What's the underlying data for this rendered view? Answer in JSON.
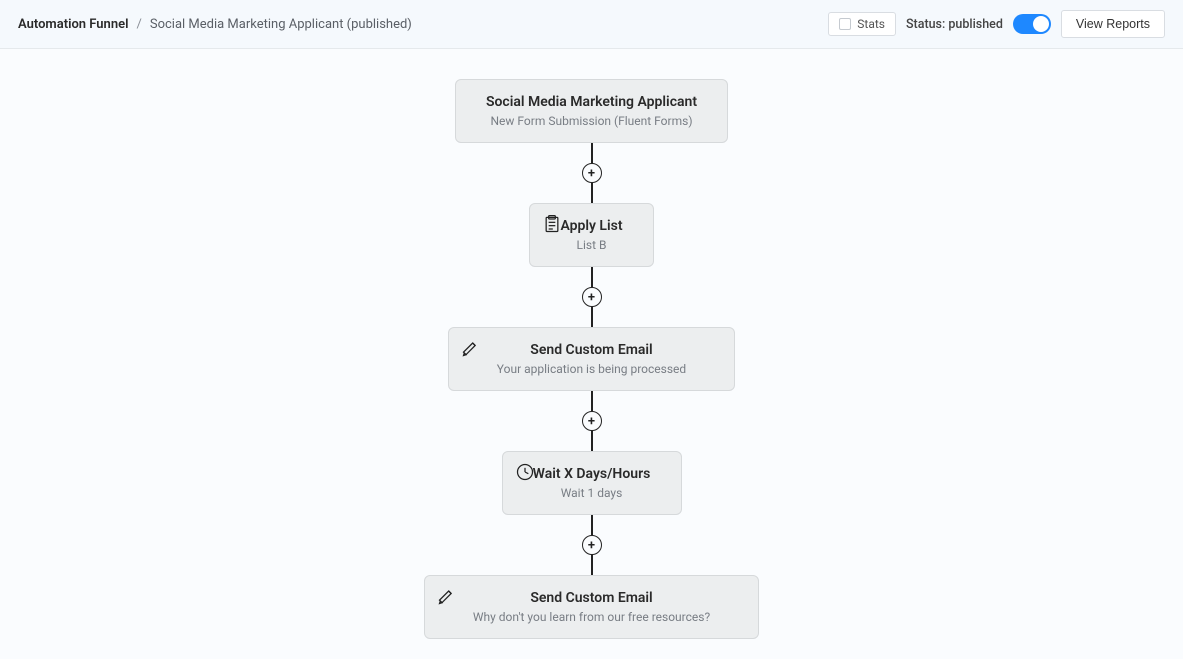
{
  "header": {
    "breadcrumb_title": "Automation Funnel",
    "breadcrumb_sep": "/",
    "breadcrumb_page": "Social Media Marketing Applicant (published)",
    "stats_label": "Stats",
    "status_label": "Status: published",
    "view_reports_label": "View Reports"
  },
  "funnel": {
    "trigger": {
      "title": "Social Media Marketing Applicant",
      "subtitle": "New Form Submission (Fluent Forms)"
    },
    "steps": [
      {
        "icon": "clipboard",
        "title": "Apply List",
        "subtitle": "List B"
      },
      {
        "icon": "pen",
        "title": "Send Custom Email",
        "subtitle": "Your application is being processed"
      },
      {
        "icon": "clock",
        "title": "Wait X Days/Hours",
        "subtitle": "Wait 1 days"
      },
      {
        "icon": "pen",
        "title": "Send Custom Email",
        "subtitle": "Why don't you learn from our free resources?"
      }
    ],
    "plus_label": "+"
  }
}
